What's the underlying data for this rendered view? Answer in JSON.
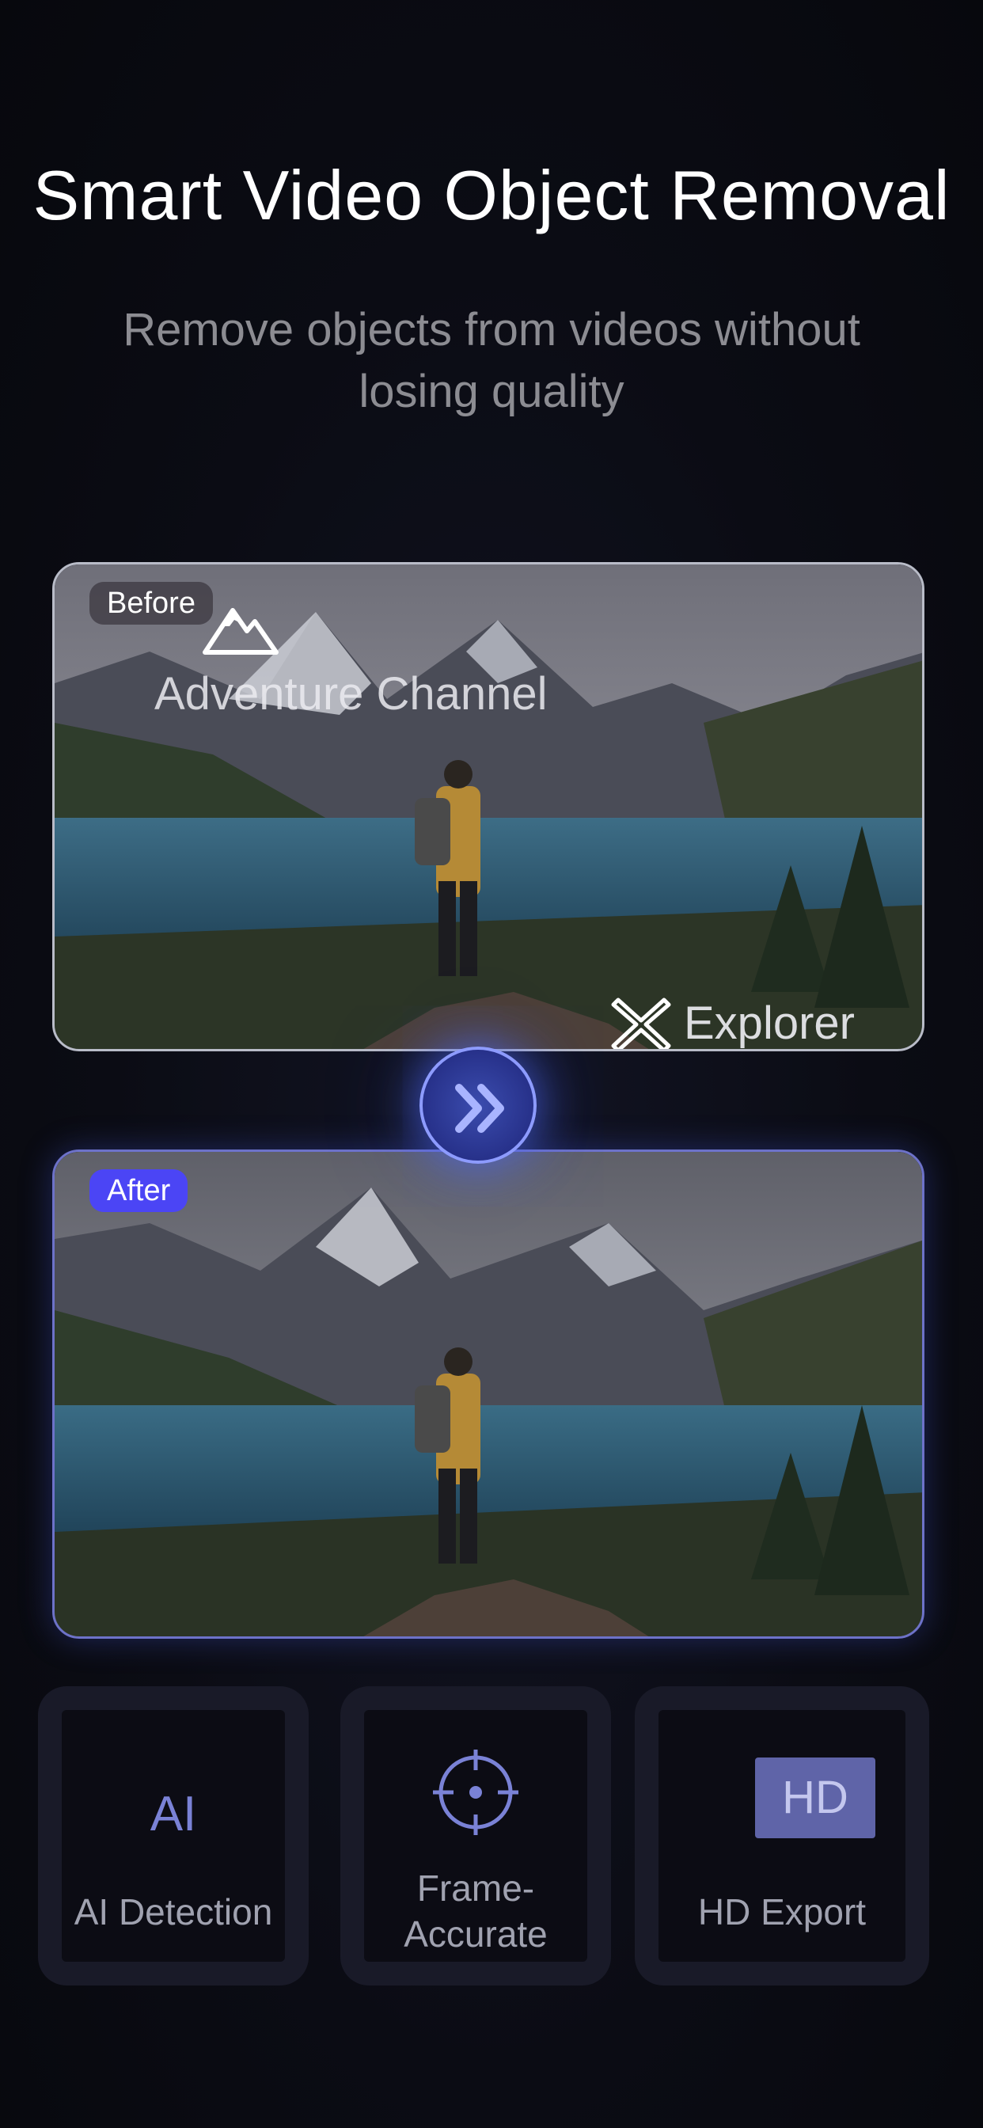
{
  "header": {
    "title": "Smart Video Object Removal",
    "subtitle": "Remove objects from videos without losing quality"
  },
  "comparison": {
    "before": {
      "badge": "Before",
      "watermark_title": "Adventure Channel",
      "watermark_corner": "Explorer"
    },
    "after": {
      "badge": "After"
    },
    "toggle_icon": "double-chevron-right-icon"
  },
  "features": [
    {
      "icon": "AI",
      "label": "AI Detection"
    },
    {
      "icon": "crosshair-icon",
      "label": "Frame-Accurate",
      "label_line1": "Frame-",
      "label_line2": "Accurate"
    },
    {
      "icon": "HD",
      "label": "HD Export"
    }
  ],
  "colors": {
    "accent": "#4b45f5",
    "background": "#0b0c14",
    "card_border_after": "#6d72c9"
  }
}
